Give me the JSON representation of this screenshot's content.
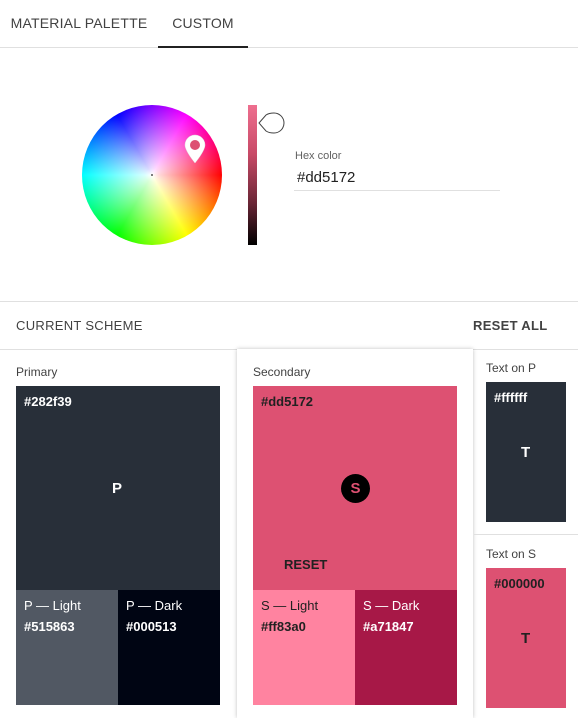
{
  "tabs": [
    {
      "label": "MATERIAL PALETTE",
      "active": false
    },
    {
      "label": "CUSTOM",
      "active": true
    }
  ],
  "picker": {
    "hex_label": "Hex color",
    "hex_value": "#dd5172",
    "selected_color": "#dd5172"
  },
  "scheme": {
    "title": "CURRENT SCHEME",
    "reset_all": "RESET ALL"
  },
  "primary": {
    "label": "Primary",
    "main_code": "#282f39",
    "letter": "P",
    "light_label": "P — Light",
    "light_code": "#515863",
    "dark_label": "P — Dark",
    "dark_code": "#000513",
    "colors": {
      "main": "#282f39",
      "light": "#515863",
      "dark": "#000513"
    }
  },
  "secondary": {
    "label": "Secondary",
    "main_code": "#dd5172",
    "letter": "S",
    "reset_label": "RESET",
    "light_label": "S — Light",
    "light_code": "#ff83a0",
    "dark_label": "S — Dark",
    "dark_code": "#a71847",
    "colors": {
      "main": "#dd5172",
      "light": "#ff83a0",
      "dark": "#a71847"
    }
  },
  "text_on_p": {
    "label": "Text on P",
    "code": "#ffffff",
    "letter": "T"
  },
  "text_on_s": {
    "label": "Text on S",
    "code": "#000000",
    "letter": "T"
  },
  "icons": [
    "color-wheel-marker-icon",
    "slider-thumb-icon"
  ]
}
